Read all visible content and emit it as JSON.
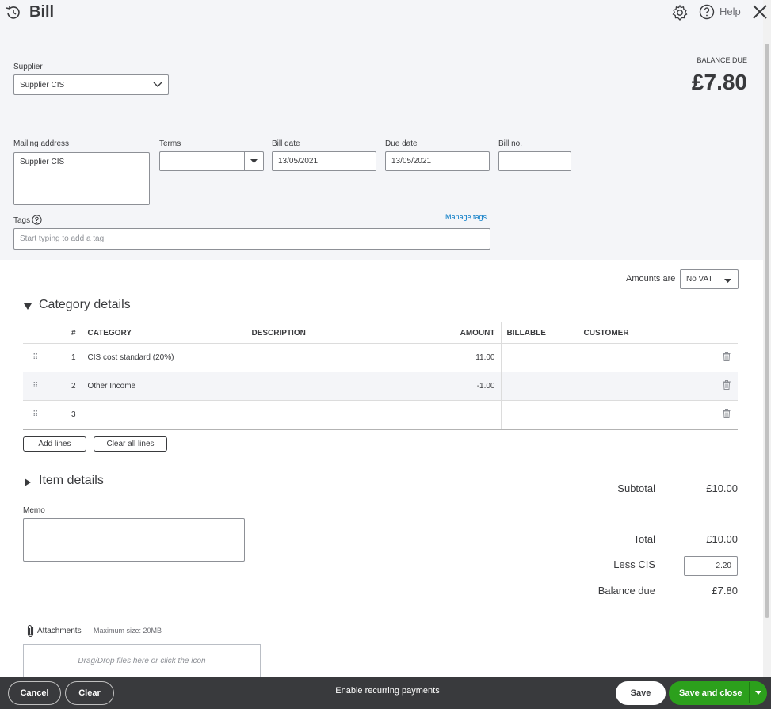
{
  "header": {
    "title": "Bill",
    "help_label": "Help"
  },
  "supplier": {
    "label": "Supplier",
    "value": "Supplier CIS"
  },
  "balance": {
    "label": "BALANCE DUE",
    "amount": "£7.80"
  },
  "fields": {
    "mailing_address_label": "Mailing address",
    "mailing_address_value": "Supplier CIS",
    "terms_label": "Terms",
    "terms_value": "",
    "bill_date_label": "Bill date",
    "bill_date_value": "13/05/2021",
    "due_date_label": "Due date",
    "due_date_value": "13/05/2021",
    "bill_no_label": "Bill no.",
    "bill_no_value": ""
  },
  "tags": {
    "label": "Tags",
    "manage_link": "Manage tags",
    "placeholder": "Start typing to add a tag"
  },
  "amounts_are": {
    "label": "Amounts are",
    "value": "No VAT"
  },
  "category": {
    "section_title": "Category details",
    "columns": [
      "#",
      "CATEGORY",
      "DESCRIPTION",
      "AMOUNT",
      "BILLABLE",
      "CUSTOMER"
    ],
    "rows": [
      {
        "num": "1",
        "category": "CIS cost standard (20%)",
        "description": "",
        "amount": "11.00",
        "billable": "",
        "customer": ""
      },
      {
        "num": "2",
        "category": "Other Income",
        "description": "",
        "amount": "-1.00",
        "billable": "",
        "customer": ""
      },
      {
        "num": "3",
        "category": "",
        "description": "",
        "amount": "",
        "billable": "",
        "customer": ""
      }
    ],
    "add_lines_label": "Add lines",
    "clear_lines_label": "Clear all lines"
  },
  "item": {
    "section_title": "Item details"
  },
  "memo": {
    "label": "Memo",
    "value": ""
  },
  "summary": {
    "subtotal_label": "Subtotal",
    "subtotal_value": "£10.00",
    "total_label": "Total",
    "total_value": "£10.00",
    "less_cis_label": "Less CIS",
    "less_cis_value": "2.20",
    "balance_due_label": "Balance due",
    "balance_due_value": "£7.80"
  },
  "attachments": {
    "label": "Attachments",
    "max_size": "Maximum size: 20MB",
    "drop_text": "Drag/Drop files here or click the icon"
  },
  "footer": {
    "cancel_label": "Cancel",
    "clear_label": "Clear",
    "recurring_label": "Enable recurring payments",
    "save_label": "Save",
    "save_close_label": "Save and close"
  },
  "colors": {
    "accent_green": "#2ca01c",
    "link_blue": "#0077c5",
    "footer_bg": "#393a3d"
  }
}
